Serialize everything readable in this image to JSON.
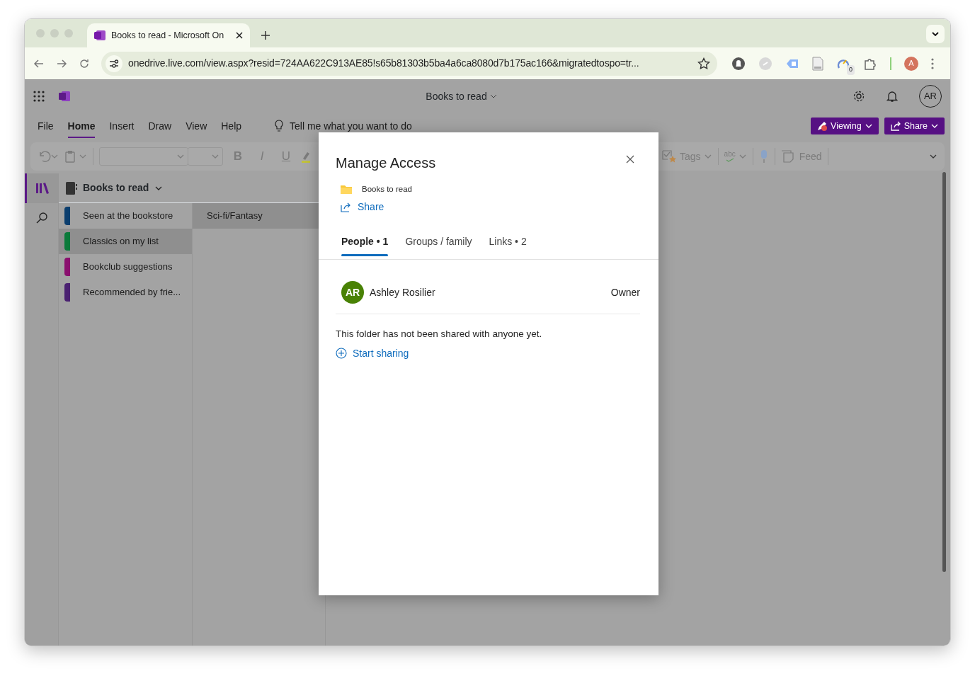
{
  "browser": {
    "tabs": [
      {
        "title": "Books to read - Microsoft On",
        "selected": true
      }
    ],
    "url": "onedrive.live.com/view.aspx?resid=724AA622C913AE85!s65b81303b5ba4a6ca8080d7b175ac166&migratedtospo=tr...",
    "extension_badge": "0",
    "profile_initial": "A"
  },
  "app": {
    "title": "Books to read",
    "user_initials": "AR",
    "search_hint": "Tell me what you want to do",
    "menu": [
      {
        "label": "File",
        "selected": false
      },
      {
        "label": "Home",
        "selected": true
      },
      {
        "label": "Insert",
        "selected": false
      },
      {
        "label": "Draw",
        "selected": false
      },
      {
        "label": "View",
        "selected": false
      },
      {
        "label": "Help",
        "selected": false
      }
    ],
    "buttons": [
      {
        "kind": "viewing",
        "label": "Viewing"
      },
      {
        "kind": "share",
        "label": "Share"
      }
    ],
    "ribbon": {
      "format": [
        "B",
        "I",
        "U"
      ],
      "tags": "Tags",
      "spell": "abc",
      "feed": "Feed"
    }
  },
  "notebook": {
    "title": "Books to read",
    "sections": [
      {
        "label": "Seen at the bookstore",
        "color": "#0b3e6e",
        "selected": false
      },
      {
        "label": "Classics on my list",
        "color": "#0b7a3a",
        "selected": true
      },
      {
        "label": "Bookclub suggestions",
        "color": "#8a0f6e",
        "selected": false
      },
      {
        "label": "Recommended by frie...",
        "color": "#4a2171",
        "selected": false
      }
    ],
    "pages": [
      {
        "label": "Sci-fi/Fantasy",
        "selected": true
      }
    ]
  },
  "dialog": {
    "title": "Manage Access",
    "item": "Books to read",
    "share_link": "Share",
    "tabs": [
      {
        "label": "People • 1",
        "selected": true
      },
      {
        "label": "Groups / family",
        "selected": false
      },
      {
        "label": "Links • 2",
        "selected": false
      }
    ],
    "people": [
      {
        "initials": "AR",
        "name": "Ashley Rosilier",
        "role": "Owner"
      }
    ],
    "message": "This folder has not been shared with anyone yet.",
    "start_sharing": "Start sharing"
  }
}
